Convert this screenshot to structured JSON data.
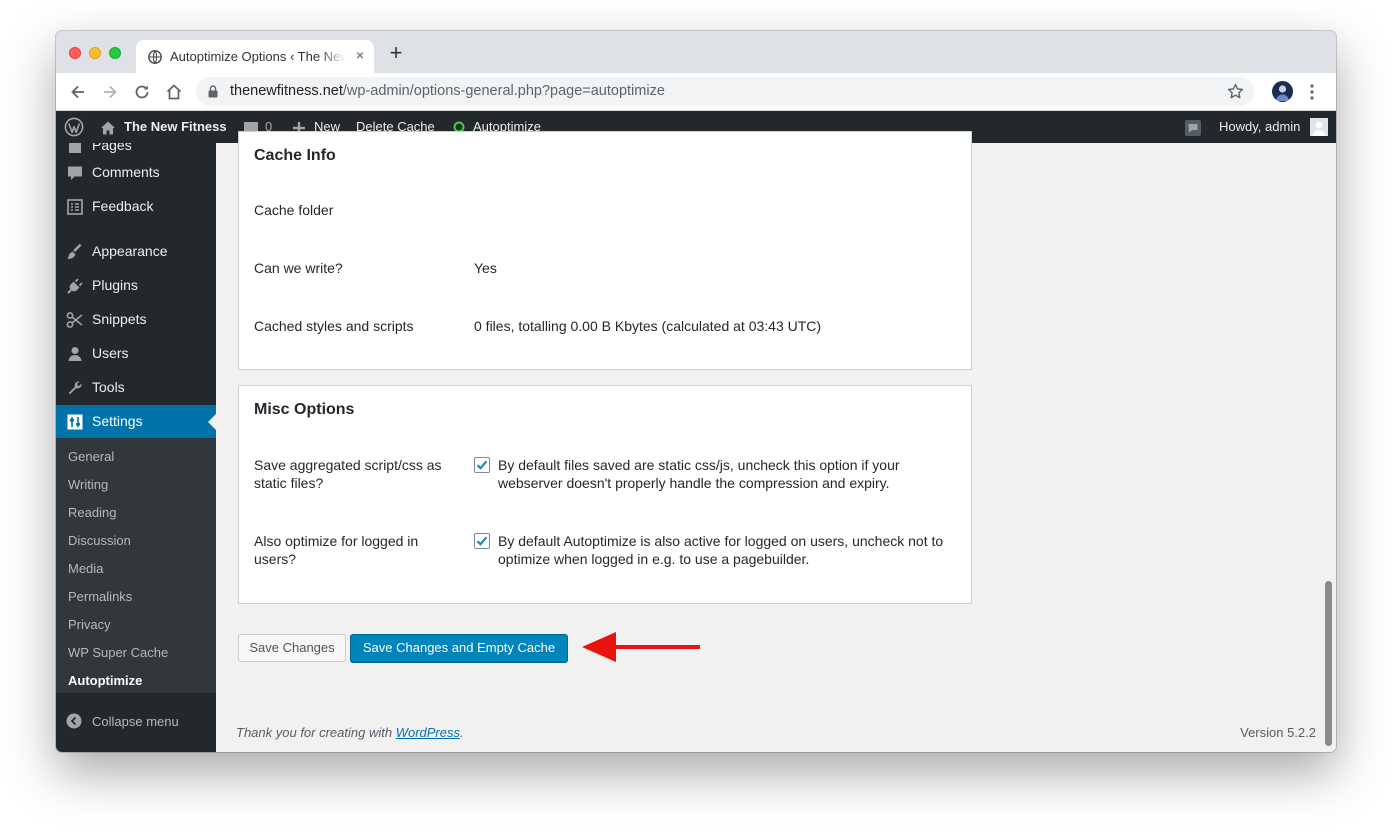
{
  "browser": {
    "tab_title": "Autoptimize Options ‹ The New Fitness",
    "tab_close": "×",
    "new_tab": "+",
    "url_domain": "thenewfitness.net",
    "url_path": "/wp-admin/options-general.php?page=autoptimize"
  },
  "adminbar": {
    "site_name": "The New Fitness",
    "comments_count": "0",
    "new_label": "New",
    "delete_cache_label": "Delete Cache",
    "autoptimize_label": "Autoptimize",
    "howdy": "Howdy, admin"
  },
  "sidebar": {
    "partial_top_label": "Pages",
    "items": [
      {
        "label": "Comments",
        "icon": "comment-icon"
      },
      {
        "label": "Feedback",
        "icon": "feedback-icon"
      },
      {
        "label": "Appearance",
        "icon": "brush-icon"
      },
      {
        "label": "Plugins",
        "icon": "plug-icon"
      },
      {
        "label": "Snippets",
        "icon": "scissors-icon"
      },
      {
        "label": "Users",
        "icon": "user-icon"
      },
      {
        "label": "Tools",
        "icon": "wrench-icon"
      },
      {
        "label": "Settings",
        "icon": "settings-icon"
      }
    ],
    "submenu": [
      "General",
      "Writing",
      "Reading",
      "Discussion",
      "Media",
      "Permalinks",
      "Privacy",
      "WP Super Cache",
      "Autoptimize"
    ],
    "collapse_label": "Collapse menu"
  },
  "cache_info": {
    "title": "Cache Info",
    "rows": [
      {
        "label": "Cache folder",
        "value": ""
      },
      {
        "label": "Can we write?",
        "value": "Yes"
      },
      {
        "label": "Cached styles and scripts",
        "value": "0 files, totalling 0.00 B Kbytes (calculated at 03:43 UTC)"
      }
    ]
  },
  "misc_options": {
    "title": "Misc Options",
    "rows": [
      {
        "label": "Save aggregated script/css as static files?",
        "checked": true,
        "desc": "By default files saved are static css/js, uncheck this option if your webserver doesn't properly handle the compression and expiry."
      },
      {
        "label": "Also optimize for logged in users?",
        "checked": true,
        "desc": "By default Autoptimize is also active for logged on users, uncheck not to optimize when logged in e.g. to use a pagebuilder."
      }
    ]
  },
  "buttons": {
    "save": "Save Changes",
    "save_empty": "Save Changes and Empty Cache"
  },
  "footer": {
    "thanks_prefix": "Thank you for creating with ",
    "wordpress_link": "WordPress",
    "thanks_suffix": ".",
    "version": "Version 5.2.2"
  },
  "colors": {
    "admin_dark": "#23282d",
    "accent": "#0073aa",
    "primary_button": "#0085ba",
    "annotation_arrow": "#e8130f"
  }
}
